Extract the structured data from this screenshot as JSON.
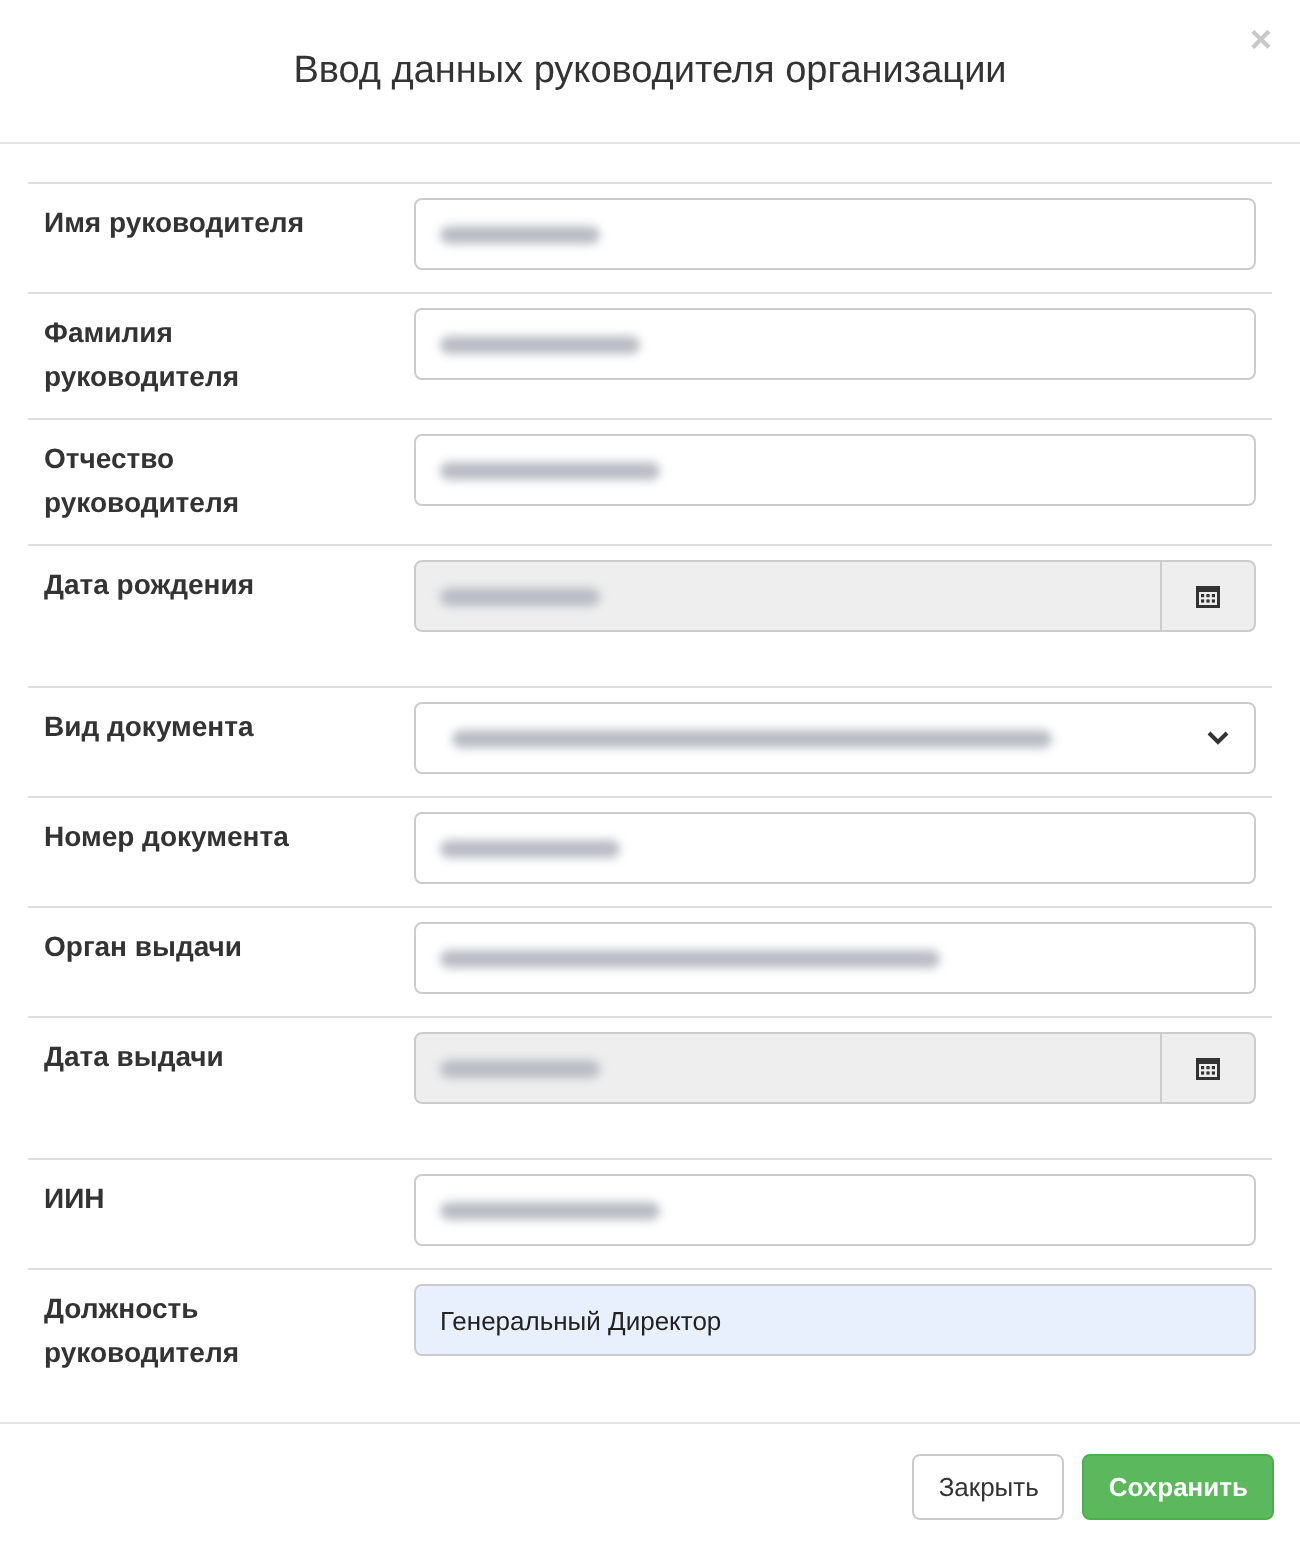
{
  "dialog": {
    "title": "Ввод данных руководителя организации",
    "close": "×"
  },
  "fields": [
    {
      "label": "Имя руководителя",
      "kind": "text"
    },
    {
      "label": "Фамилия руководителя",
      "kind": "text"
    },
    {
      "label": "Отчество руководителя",
      "kind": "text"
    },
    {
      "label": "Дата рождения",
      "kind": "date"
    },
    {
      "label": "Вид документа",
      "kind": "select"
    },
    {
      "label": "Номер документа",
      "kind": "text"
    },
    {
      "label": "Орган выдачи",
      "kind": "text"
    },
    {
      "label": "Дата выдачи",
      "kind": "date"
    },
    {
      "label": "ИИН",
      "kind": "text"
    },
    {
      "label": "Должность руководителя",
      "kind": "text",
      "value": "Генеральный Директор",
      "autofilled": true
    }
  ],
  "buttons": [
    {
      "label": "Закрыть",
      "kind": "default"
    },
    {
      "label": "Сохранить",
      "kind": "primary"
    }
  ]
}
